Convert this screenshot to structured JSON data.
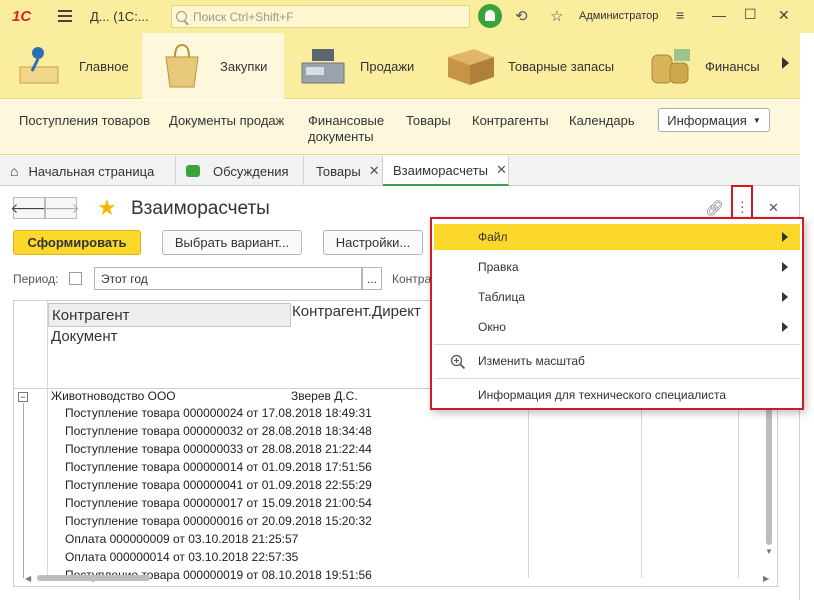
{
  "titlebar": {
    "logo": "1С",
    "window_title": "Д... (1С:...",
    "search_placeholder": "Поиск Ctrl+Shift+F",
    "user": "Администратор"
  },
  "sections": [
    {
      "label": "Главное"
    },
    {
      "label": "Закупки"
    },
    {
      "label": "Продажи"
    },
    {
      "label": "Товарные запасы"
    },
    {
      "label": "Финансы"
    }
  ],
  "subnav": {
    "links": [
      "Поступления товаров",
      "Документы продаж",
      "Финансовые документы",
      "Товары",
      "Контрагенты",
      "Календарь"
    ],
    "info_button": "Информация"
  },
  "tabs": [
    {
      "label": "Начальная страница"
    },
    {
      "label": "Обсуждения"
    },
    {
      "label": "Товары"
    },
    {
      "label": "Взаиморасчеты"
    }
  ],
  "form": {
    "title": "Взаиморасчеты",
    "buttons": {
      "generate": "Сформировать",
      "choose_variant": "Выбрать вариант...",
      "settings": "Настройки..."
    },
    "period_label": "Период:",
    "period_value": "Этот год",
    "dots": "...",
    "counterparty_label": "Контраг"
  },
  "report": {
    "headers": {
      "col1": "Контрагент",
      "col2": "Контрагент.Директ",
      "col3": "Документ"
    },
    "group": {
      "name": "Животноводство ООО",
      "director": "Зверев Д.С."
    },
    "rows": [
      "Поступление товара 000000024 от 17.08.2018 18:49:31",
      "Поступление товара 000000032 от 28.08.2018 18:34:48",
      "Поступление товара 000000033 от 28.08.2018 21:22:44",
      "Поступление товара 000000014 от 01.09.2018 17:51:56",
      "Поступление товара 000000041 от 01.09.2018 22:55:29",
      "Поступление товара 000000017 от 15.09.2018 21:00:54",
      "Поступление товара 000000016 от 20.09.2018 15:20:32",
      "Оплата 000000009 от 03.10.2018 21:25:57",
      "Оплата 000000014 от 03.10.2018 22:57:35",
      "Поступление товара 000000019 от 08.10.2018 19:51:56"
    ]
  },
  "menu": {
    "items": [
      {
        "label": "Файл",
        "submenu": true
      },
      {
        "label": "Правка",
        "submenu": true
      },
      {
        "label": "Таблица",
        "submenu": true
      },
      {
        "label": "Окно",
        "submenu": true
      },
      {
        "label": "Изменить масштаб",
        "submenu": false
      },
      {
        "label": "Информация для технического специалиста",
        "submenu": false
      }
    ]
  },
  "colors": {
    "accent_yellow": "#fbd82a",
    "panel_yellow": "#fbed9e",
    "highlight_red": "#d11a23",
    "active_green": "#3aa33c"
  }
}
